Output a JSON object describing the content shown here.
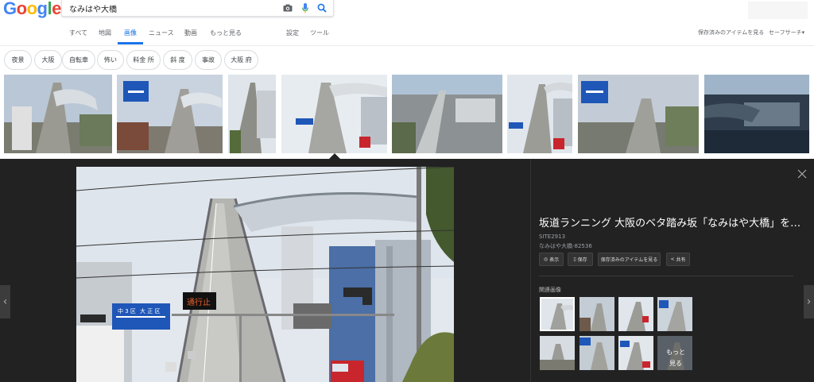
{
  "header": {
    "logo": "Google",
    "logo_colors": [
      "#4285f4",
      "#ea4335",
      "#fbbc05",
      "#4285f4",
      "#34a853",
      "#ea4335"
    ],
    "query": "なみはや大橋",
    "camera_icon": "camera-icon",
    "mic_icon": "mic-icon",
    "search_icon": "search-icon"
  },
  "tabs": {
    "all": "すべて",
    "maps": "地図",
    "images": "画像",
    "news": "ニュース",
    "videos": "動画",
    "more": "もっと見る",
    "settings": "設定",
    "tools": "ツール",
    "saved": "保存済みのアイテムを見る",
    "safesearch": "セーフサーチ▾"
  },
  "chips": [
    "夜景",
    "大阪",
    "自転車",
    "怖い",
    "料金 所",
    "斜 度",
    "事故",
    "大阪 府"
  ],
  "panel": {
    "title": "坂道ランニング 大阪のベタ踏み坂「なみはや大橋」を…",
    "site": "SITE2913",
    "size": "なみはや大橋-82536",
    "actions": [
      "表示",
      "保存",
      "保存済みのアイテムを見る",
      "共有"
    ],
    "related_label": "関連画像",
    "more_line1": "もっと",
    "more_line2": "見る",
    "sign_direction": "大 正 区",
    "sign_left": "中 3 区",
    "led_text": "通行止"
  },
  "colors": {
    "accent": "#1a73e8",
    "panel_bg": "#222222"
  }
}
